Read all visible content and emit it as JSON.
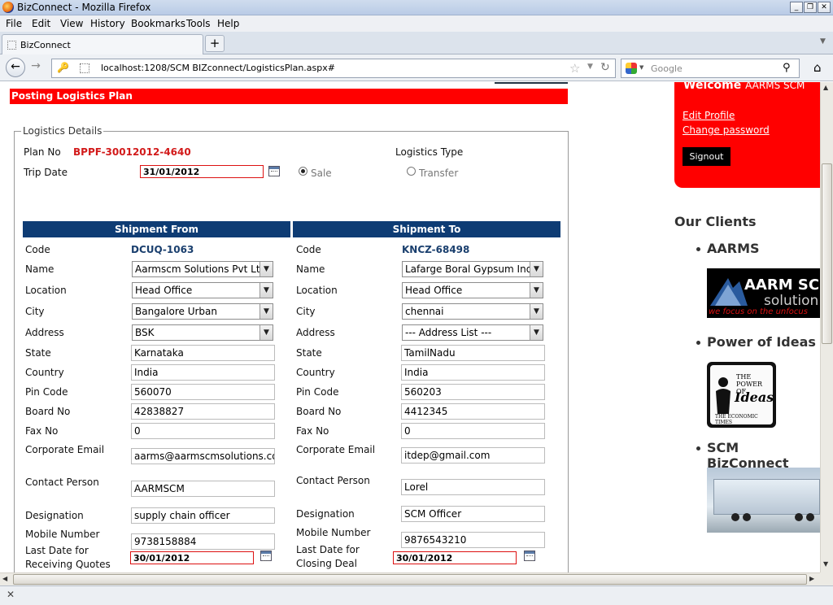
{
  "window": {
    "title": "BizConnect - Mozilla Firefox",
    "controls": [
      "_",
      "❐",
      "✕"
    ]
  },
  "menu": [
    "File",
    "Edit",
    "View",
    "History",
    "Bookmarks",
    "Tools",
    "Help"
  ],
  "tab": {
    "label": "BizConnect"
  },
  "url": "localhost:1208/SCM BIZconnect/LogisticsPlan.aspx#",
  "search": {
    "placeholder": "Google"
  },
  "page": {
    "header": "Posting Logistics Plan",
    "legend": "Logistics Details",
    "plan_no_label": "Plan No",
    "plan_no": "BPPF-30012012-4640",
    "trip_date_label": "Trip Date",
    "trip_date": "31/01/2012",
    "logistics_type_label": "Logistics Type",
    "type_sale": "Sale",
    "type_transfer": "Transfer",
    "from_header": "Shipment From",
    "to_header": "Shipment To",
    "labels": {
      "code": "Code",
      "name": "Name",
      "location": "Location",
      "city": "City",
      "address": "Address",
      "state": "State",
      "country": "Country",
      "pin": "Pin Code",
      "board": "Board No",
      "fax": "Fax No",
      "email": "Corporate Email",
      "contact": "Contact Person",
      "designation": "Designation",
      "mobile": "Mobile Number",
      "last_quotes": "Last Date for\nReceiving Quotes",
      "last_deal": "Last Date for\nClosing Deal"
    },
    "from": {
      "code": "DCUQ-1063",
      "name": "Aarmscm Solutions Pvt Ltd",
      "location": "Head Office",
      "city": "Bangalore Urban",
      "address": "BSK",
      "state": "Karnataka",
      "country": "India",
      "pin": "560070",
      "board": "42838827",
      "fax": "0",
      "email": "aarms@aarmscmsolutions.com",
      "contact": "AARMSCM",
      "designation": "supply chain officer",
      "mobile": "9738158884",
      "last_date": "30/01/2012"
    },
    "to": {
      "code": "KNCZ-68498",
      "name": "Lafarge Boral Gypsum India",
      "location": "Head Office",
      "city": "chennai",
      "address": "--- Address List ---",
      "state": "TamilNadu",
      "country": "India",
      "pin": "560203",
      "board": "4412345",
      "fax": "0",
      "email": "itdep@gmail.com",
      "contact": "Lorel",
      "designation": "SCM Officer",
      "mobile": "9876543210",
      "last_date": "30/01/2012"
    }
  },
  "sidebar": {
    "welcome": "Welcome",
    "user": "AARMS SCM",
    "edit_profile": "Edit Profile",
    "change_password": "Change password",
    "signout": "Signout",
    "clients_title": "Our Clients",
    "clients": [
      "AARMS",
      "Power of Ideas",
      "SCM BizConnect"
    ],
    "aarm_logo_text": "AARM SC",
    "aarm_logo_sub": "solution",
    "aarm_logo_tag": "we focus on the unfocus",
    "ideas_logo_top": "THE POWER OF",
    "ideas_logo_main": "Ideas",
    "ideas_logo_bottom": "THE ECONOMIC TIMES"
  },
  "status": {
    "close": "✕"
  }
}
